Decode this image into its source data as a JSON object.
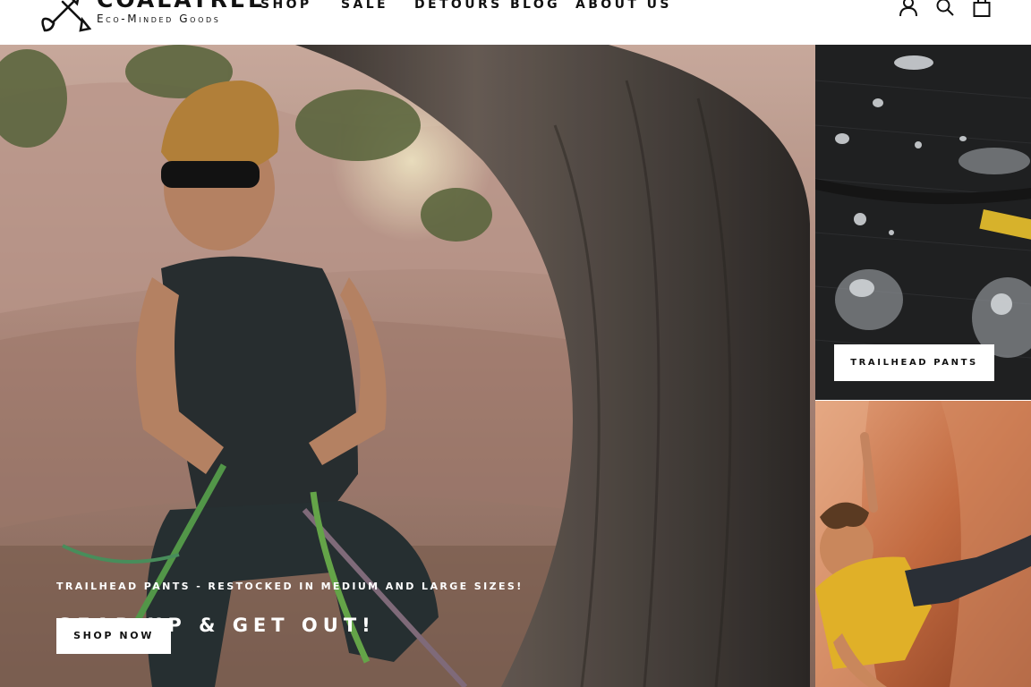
{
  "brand": {
    "name": "COALATREE",
    "tagline": "Eco-Minded Goods"
  },
  "nav": {
    "items": [
      "SHOP",
      "SALE",
      "DETOURS BLOG",
      "ABOUT US"
    ]
  },
  "header_icons": [
    "account-icon",
    "search-icon",
    "cart-icon"
  ],
  "hero": {
    "kicker": "TRAILHEAD PANTS - RESTOCKED IN MEDIUM AND LARGE SIZES!",
    "title": "GEAR UP & GET OUT!",
    "button_label": "SHOP NOW"
  },
  "tiles": {
    "top": {
      "button_label": "TRAILHEAD PANTS"
    },
    "bottom": {}
  },
  "colors": {
    "text": "#111111",
    "background": "#ffffff",
    "button_bg": "#ffffff"
  }
}
